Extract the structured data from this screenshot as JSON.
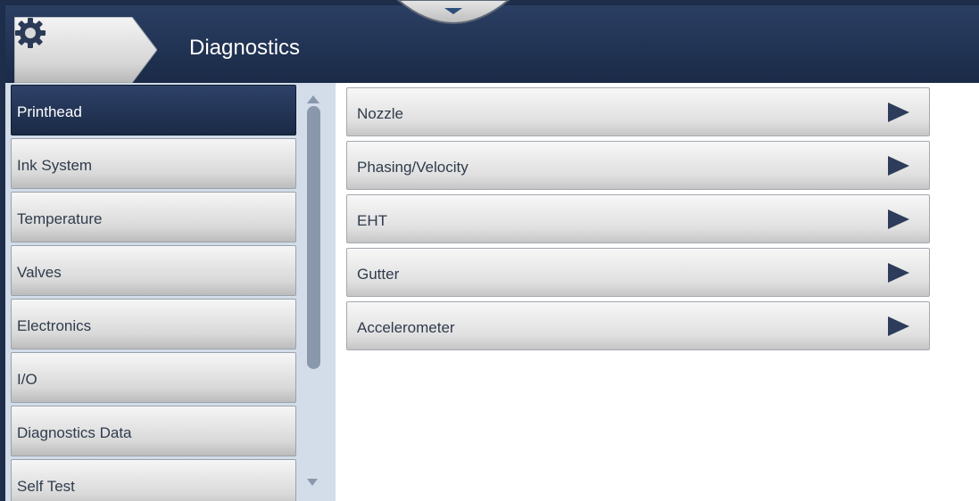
{
  "header": {
    "title": "Diagnostics",
    "settings_icon": "gear-icon",
    "dropdown_icon": "chevron-down-icon"
  },
  "sidebar": {
    "items": [
      {
        "label": "Printhead",
        "active": true
      },
      {
        "label": "Ink System"
      },
      {
        "label": "Temperature"
      },
      {
        "label": "Valves"
      },
      {
        "label": "Electronics"
      },
      {
        "label": "I/O"
      },
      {
        "label": "Diagnostics Data"
      },
      {
        "label": "Self Test"
      }
    ]
  },
  "main": {
    "items": [
      {
        "label": "Nozzle"
      },
      {
        "label": "Phasing/Velocity"
      },
      {
        "label": "EHT"
      },
      {
        "label": "Gutter"
      },
      {
        "label": "Accelerometer"
      }
    ]
  },
  "colors": {
    "header": "#1d2d4a",
    "active": "#24365a",
    "panel": "#d3dde9",
    "arrow": "#2c3c5a"
  }
}
